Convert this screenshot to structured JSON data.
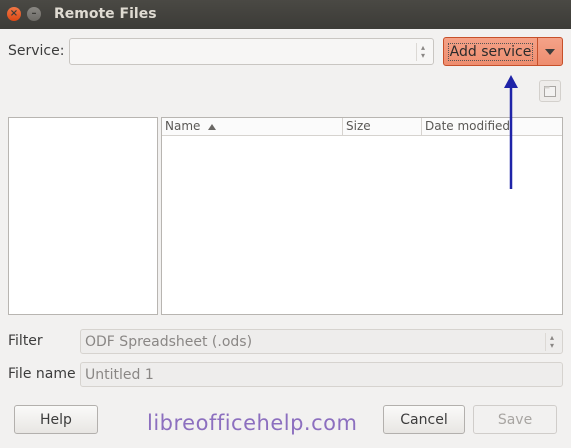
{
  "window": {
    "title": "Remote Files"
  },
  "service": {
    "label": "Service:",
    "value": ""
  },
  "add_service": {
    "label": "Add service"
  },
  "file_list": {
    "columns": [
      "Name",
      "Size",
      "Date modified"
    ]
  },
  "filter": {
    "label": "Filter",
    "value": "ODF Spreadsheet (.ods)"
  },
  "file_name": {
    "label": "File name",
    "value": "Untitled 1"
  },
  "buttons": {
    "help": "Help",
    "cancel": "Cancel",
    "save": "Save"
  },
  "watermark": "libreofficehelp.com",
  "colors": {
    "accent": "#ee8d6f",
    "annotation_arrow": "#1f24a8",
    "titlebar": "#3c3b37"
  },
  "icons": [
    "close-icon",
    "minimize-icon",
    "chevron-down-icon",
    "new-folder-icon",
    "sort-ascending-icon",
    "spin-arrows-icon"
  ]
}
